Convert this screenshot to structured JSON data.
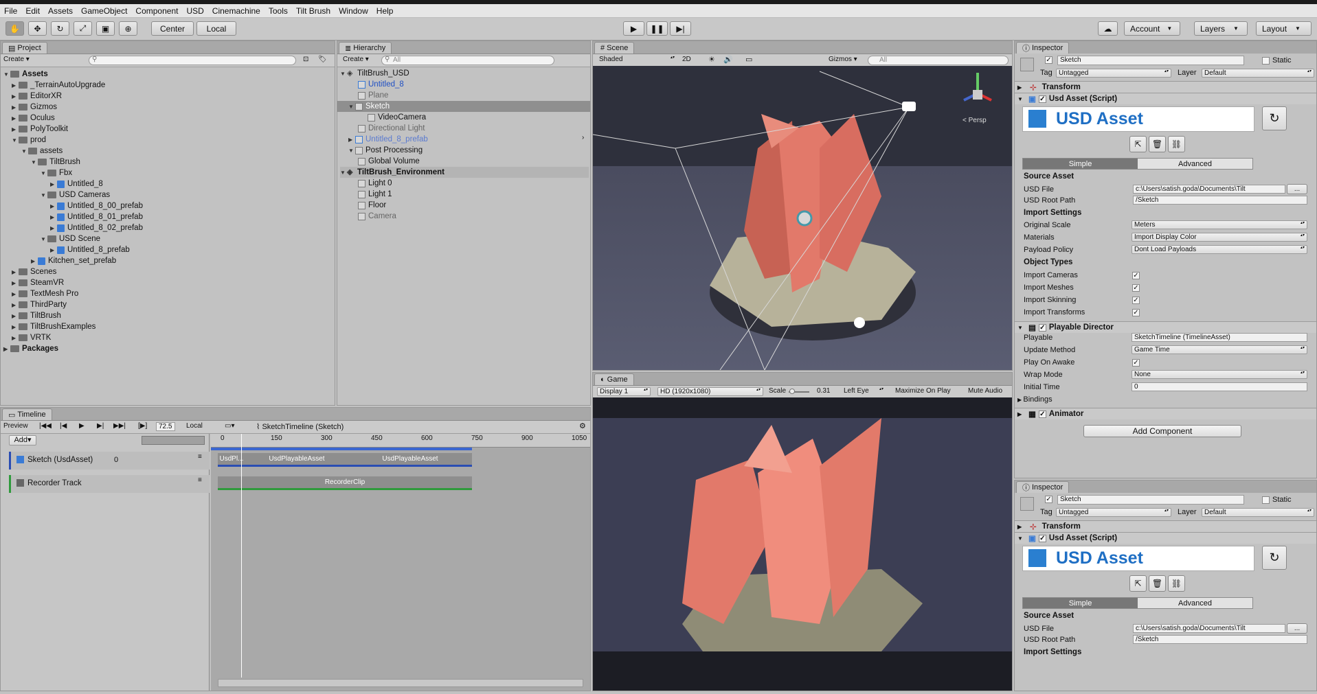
{
  "menu": [
    "File",
    "Edit",
    "Assets",
    "GameObject",
    "Component",
    "USD",
    "Cinemachine",
    "Tools",
    "Tilt Brush",
    "Window",
    "Help"
  ],
  "toolbar": {
    "pivot": "Center",
    "space": "Local",
    "account": "Account",
    "layers": "Layers",
    "layout": "Layout"
  },
  "project": {
    "tab": "Project",
    "create": "Create",
    "root": "Assets",
    "items": [
      {
        "label": "_TerrainAutoUpgrade"
      },
      {
        "label": "EditorXR"
      },
      {
        "label": "Gizmos"
      },
      {
        "label": "Oculus"
      },
      {
        "label": "PolyToolkit"
      },
      {
        "label": "prod"
      },
      {
        "label": "assets"
      },
      {
        "label": "TiltBrush"
      },
      {
        "label": "Fbx"
      },
      {
        "label": "Untitled_8"
      },
      {
        "label": "USD Cameras"
      },
      {
        "label": "Untitled_8_00_prefab"
      },
      {
        "label": "Untitled_8_01_prefab"
      },
      {
        "label": "Untitled_8_02_prefab"
      },
      {
        "label": "USD Scene"
      },
      {
        "label": "Untitled_8_prefab"
      },
      {
        "label": "Kitchen_set_prefab"
      },
      {
        "label": "Scenes"
      },
      {
        "label": "SteamVR"
      },
      {
        "label": "TextMesh Pro"
      },
      {
        "label": "ThirdParty"
      },
      {
        "label": "TiltBrush"
      },
      {
        "label": "TiltBrushExamples"
      },
      {
        "label": "VRTK"
      }
    ],
    "packages": "Packages"
  },
  "hierarchy": {
    "tab": "Hierarchy",
    "create": "Create",
    "search_placeholder": "All",
    "items": [
      {
        "label": "TiltBrush_USD"
      },
      {
        "label": "Untitled_8"
      },
      {
        "label": "Plane"
      },
      {
        "label": "Sketch"
      },
      {
        "label": "VideoCamera"
      },
      {
        "label": "Directional Light"
      },
      {
        "label": "Untitled_8_prefab"
      },
      {
        "label": "Post Processing"
      },
      {
        "label": "Global Volume"
      },
      {
        "label": "TiltBrush_Environment"
      },
      {
        "label": "Light 0"
      },
      {
        "label": "Light 1"
      },
      {
        "label": "Floor"
      },
      {
        "label": "Camera"
      }
    ]
  },
  "scene": {
    "tab": "Scene",
    "shading": "Shaded",
    "mode2d": "2D",
    "gizmos": "Gizmos",
    "search_placeholder": "All",
    "persp": "Persp"
  },
  "game": {
    "tab": "Game",
    "display": "Display 1",
    "resolution": "HD (1920x1080)",
    "scale_label": "Scale",
    "scale_value": "0.31",
    "eye": "Left Eye",
    "maximize": "Maximize On Play",
    "mute": "Mute Audio"
  },
  "timeline": {
    "tab": "Timeline",
    "preview": "Preview",
    "frame": "72.5",
    "local": "Local",
    "asset": "SketchTimeline (Sketch)",
    "add": "Add",
    "ruler": [
      "0",
      "150",
      "300",
      "450",
      "600",
      "750",
      "900",
      "1050"
    ],
    "tracks": [
      {
        "label": "Sketch (UsdAsset)",
        "extra": "0"
      },
      {
        "label": "Recorder Track"
      }
    ],
    "clips": [
      "UsdPl...",
      "UsdPlayableAsset",
      "UsdPlayableAsset",
      "RecorderClip"
    ]
  },
  "inspector1": {
    "tab": "Inspector",
    "name": "Sketch",
    "static": "Static",
    "tag_label": "Tag",
    "tag": "Untagged",
    "layer_label": "Layer",
    "layer": "Default",
    "transform": "Transform",
    "usd_script": "Usd Asset (Script)",
    "usd_title": "USD Asset",
    "simple": "Simple",
    "advanced": "Advanced",
    "source_asset": "Source Asset",
    "usd_file_label": "USD File",
    "usd_file": "c:\\Users\\satish.goda\\Documents\\Tilt",
    "browse": "...",
    "root_path_label": "USD Root Path",
    "root_path": "/Sketch",
    "import_settings": "Import Settings",
    "original_scale_label": "Original Scale",
    "original_scale": "Meters",
    "materials_label": "Materials",
    "materials": "Import Display Color",
    "payload_label": "Payload Policy",
    "payload": "Dont Load Payloads",
    "object_types": "Object Types",
    "import_cameras": "Import Cameras",
    "import_meshes": "Import Meshes",
    "import_skinning": "Import Skinning",
    "import_transforms": "Import Transforms",
    "playable_director": "Playable Director",
    "playable_label": "Playable",
    "playable": "SketchTimeline (TimelineAsset)",
    "update_method_label": "Update Method",
    "update_method": "Game Time",
    "play_on_awake": "Play On Awake",
    "wrap_mode_label": "Wrap Mode",
    "wrap_mode": "None",
    "initial_time_label": "Initial Time",
    "initial_time": "0",
    "bindings": "Bindings",
    "animator": "Animator",
    "add_component": "Add Component"
  },
  "inspector2": {
    "tab": "Inspector",
    "name": "Sketch",
    "static": "Static",
    "tag_label": "Tag",
    "tag": "Untagged",
    "layer_label": "Layer",
    "layer": "Default",
    "transform": "Transform",
    "usd_script": "Usd Asset (Script)",
    "usd_title": "USD Asset",
    "simple": "Simple",
    "advanced": "Advanced",
    "source_asset": "Source Asset",
    "usd_file_label": "USD File",
    "usd_file": "c:\\Users\\satish.goda\\Documents\\Tilt",
    "browse": "...",
    "root_path_label": "USD Root Path",
    "root_path": "/Sketch",
    "import_settings": "Import Settings"
  },
  "colors": {
    "accent_blue": "#1f6fc4",
    "selection": "#3d7ad6",
    "sculpture": "#e2796a",
    "recorder_green": "#2f9a3c",
    "usd_track_blue": "#2a4db3"
  }
}
